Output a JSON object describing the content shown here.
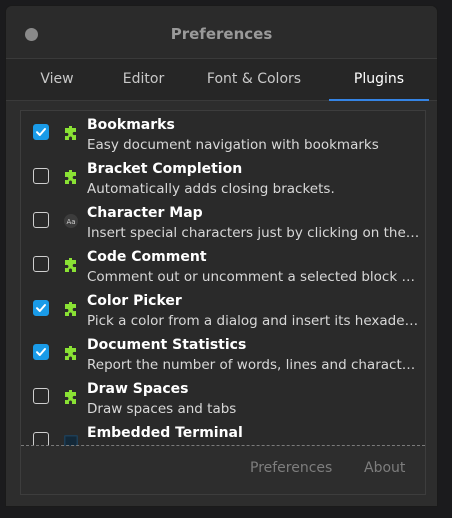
{
  "window": {
    "title": "Preferences"
  },
  "tabs": [
    {
      "label": "View"
    },
    {
      "label": "Editor"
    },
    {
      "label": "Font & Colors"
    },
    {
      "label": "Plugins",
      "active": true
    }
  ],
  "plugins": [
    {
      "name": "Bookmarks",
      "description": "Easy document navigation with bookmarks",
      "checked": true,
      "icon": "puzzle-icon"
    },
    {
      "name": "Bracket Completion",
      "description": "Automatically adds closing brackets.",
      "checked": false,
      "icon": "puzzle-icon"
    },
    {
      "name": "Character Map",
      "description": "Insert special characters just by clicking on them.",
      "checked": false,
      "icon": "character-map-icon"
    },
    {
      "name": "Code Comment",
      "description": "Comment out or uncomment a selected block of c…",
      "checked": false,
      "icon": "puzzle-icon"
    },
    {
      "name": "Color Picker",
      "description": "Pick a color from a dialog and insert its hexadeci…",
      "checked": true,
      "icon": "puzzle-icon"
    },
    {
      "name": "Document Statistics",
      "description": "Report the number of words, lines and character…",
      "checked": true,
      "icon": "puzzle-icon"
    },
    {
      "name": "Draw Spaces",
      "description": "Draw spaces and tabs",
      "checked": false,
      "icon": "puzzle-icon"
    },
    {
      "name": "Embedded Terminal",
      "description": "",
      "checked": false,
      "icon": "terminal-icon"
    }
  ],
  "footer": {
    "preferences_label": "Preferences",
    "about_label": "About"
  },
  "colors": {
    "accent": "#3584e4",
    "checkbox_checked": "#1a9be8",
    "puzzle_green": "#8ae234"
  }
}
